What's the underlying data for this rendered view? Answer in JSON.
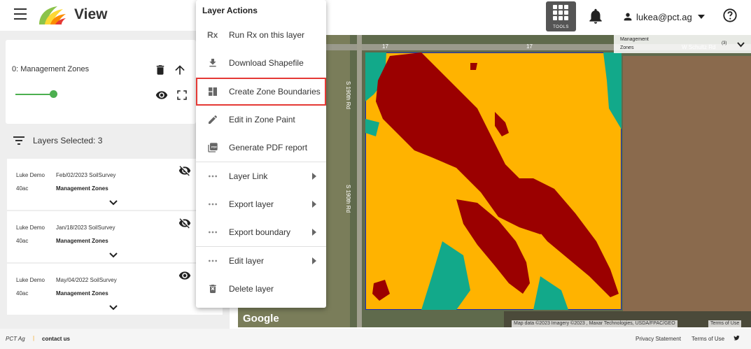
{
  "header": {
    "app_title": "View",
    "tools_label": "TOOLS",
    "user_email": "lukea@pct.ag",
    "icons": [
      "hamburger-icon",
      "logo",
      "tools-grid-icon",
      "bell-icon",
      "person-icon",
      "help-icon"
    ]
  },
  "active_layer": {
    "label": "0: Management Zones",
    "opacity": 1.0,
    "accent_color": "#4caf50"
  },
  "layers_selected": "Layers Selected: 3",
  "layers": [
    {
      "user": "Luke Demo",
      "date": "Feb/02/2023 SoilSurvey",
      "acres": "40ac",
      "name": "Management Zones",
      "visible": false
    },
    {
      "user": "Luke Demo",
      "date": "Jan/18/2023 SoilSurvey",
      "acres": "40ac",
      "name": "Management Zones",
      "visible": false
    },
    {
      "user": "Luke Demo",
      "date": "May/04/2022 SoilSurvey",
      "acres": "40ac",
      "name": "Management Zones",
      "visible": true
    }
  ],
  "menu": {
    "title": "Layer Actions",
    "items": [
      {
        "label": "Run Rx on this layer",
        "icon": "rx-icon"
      },
      {
        "label": "Download Shapefile",
        "icon": "download-icon"
      },
      {
        "label": "Create Zone Boundaries",
        "icon": "zone-boundaries-icon",
        "highlighted": true
      },
      {
        "label": "Edit in Zone Paint",
        "icon": "pencil-icon"
      },
      {
        "label": "Generate PDF report",
        "icon": "pdf-icon"
      },
      {
        "label": "Layer Link",
        "icon": "more-icon",
        "submenu": true
      },
      {
        "label": "Export layer",
        "icon": "more-icon",
        "submenu": true
      },
      {
        "label": "Export boundary",
        "icon": "more-icon",
        "submenu": true
      },
      {
        "label": "Edit layer",
        "icon": "more-icon",
        "submenu": true
      },
      {
        "label": "Delete layer",
        "icon": "delete-icon"
      }
    ],
    "highlight_color": "#e53935"
  },
  "map": {
    "legend_line1": "Management",
    "legend_line2": "Zones",
    "legend_road": "W Schultz Rd",
    "legend_count": "(3)",
    "road_labels": [
      "17",
      "17",
      "S 190th Rd",
      "S 190th Rd"
    ],
    "google": "Google",
    "attribution": "Map data ©2023 Imagery ©2023 , Maxar Technologies, USDA/FPAC/GEO",
    "terms": "Terms of Use",
    "zone_colors": {
      "high": "#ffb300",
      "low": "#9b0000",
      "mid": "#12a98a"
    }
  },
  "footer": {
    "brand": "PCT Ag",
    "separator": "|",
    "contact": "contact us",
    "privacy": "Privacy Statement",
    "terms": "Terms of Use",
    "twitter_icon": "twitter-icon"
  }
}
